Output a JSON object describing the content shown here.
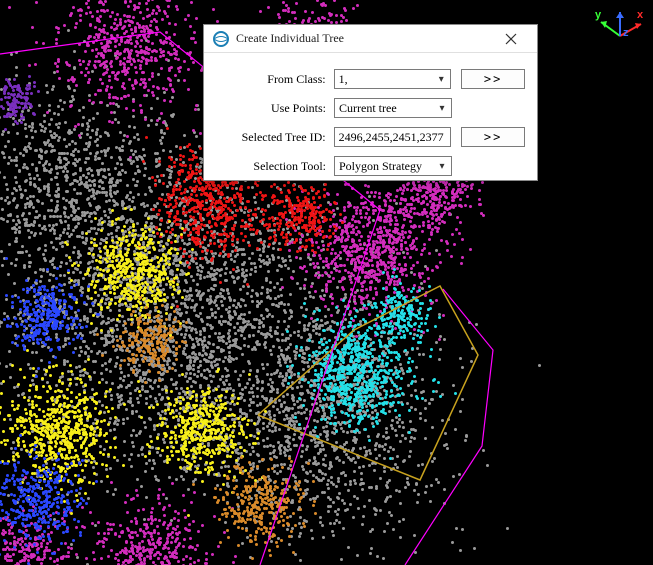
{
  "dialog": {
    "title": "Create Individual Tree",
    "fields": {
      "from_class": {
        "label": "From Class:",
        "value": "1,",
        "button": ">>"
      },
      "use_points": {
        "label": "Use Points:",
        "value": "Current tree"
      },
      "selected_tree_id": {
        "label": "Selected Tree ID:",
        "value": "2496,2455,2451,2377",
        "button": ">>"
      },
      "selection_tool": {
        "label": "Selection Tool:",
        "value": "Polygon Strategy"
      }
    }
  },
  "axis": {
    "x_label": "x",
    "y_label": "y",
    "z_label": "z",
    "x_color": "#ff2a2a",
    "y_color": "#36ff36",
    "z_color": "#3a6cff"
  },
  "polygons": {
    "selection_outline_color": "#c8a21e",
    "boundary_magenta_color": "#ff00ff"
  },
  "clusters": {
    "colors": {
      "gray": "#9a9a9a",
      "magenta": "#d32dbd",
      "yellow": "#f7ef1b",
      "red": "#ef1515",
      "cyan": "#24e0e8",
      "blue": "#2b48ff",
      "orange": "#d98a2a",
      "purple": "#7a2fbf"
    }
  }
}
